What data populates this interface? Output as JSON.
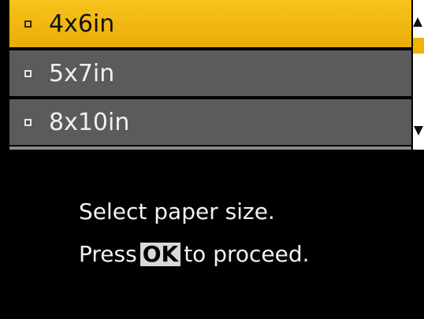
{
  "paper_size_menu": {
    "items": [
      {
        "label": "4x6in",
        "selected": true
      },
      {
        "label": "5x7in",
        "selected": false
      },
      {
        "label": "8x10in",
        "selected": false
      }
    ]
  },
  "scrollbar": {
    "up_icon": "up-arrow-icon",
    "down_icon": "down-arrow-icon"
  },
  "message": {
    "line1": "Select paper size.",
    "line2_before": "Press",
    "ok_label": "OK",
    "line2_after": "to proceed."
  },
  "colors": {
    "selected_bg": "#f7c31c",
    "item_bg": "#5b5b5b",
    "screen_bg": "#000000"
  }
}
